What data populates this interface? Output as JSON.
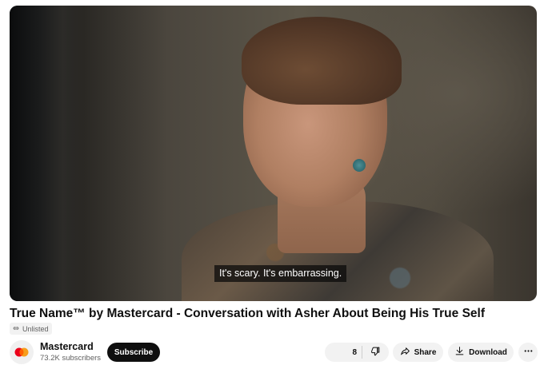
{
  "video": {
    "caption": "It's scary. It's embarrassing.",
    "title": "True Name™ by Mastercard - Conversation with Asher About Being His True Self",
    "visibility": "Unlisted"
  },
  "channel": {
    "name": "Mastercard",
    "subscribers": "73.2K subscribers",
    "subscribe_label": "Subscribe",
    "logo_colors": {
      "left": "#eb001b",
      "right": "#f79e1b",
      "overlap": "#ff5f00"
    }
  },
  "actions": {
    "like_count": "8",
    "share_label": "Share",
    "download_label": "Download"
  },
  "icons": {
    "visibility": "link-icon",
    "dislike": "thumb-down-icon",
    "share": "share-arrow-icon",
    "download": "download-icon",
    "more": "more-horizontal-icon"
  }
}
